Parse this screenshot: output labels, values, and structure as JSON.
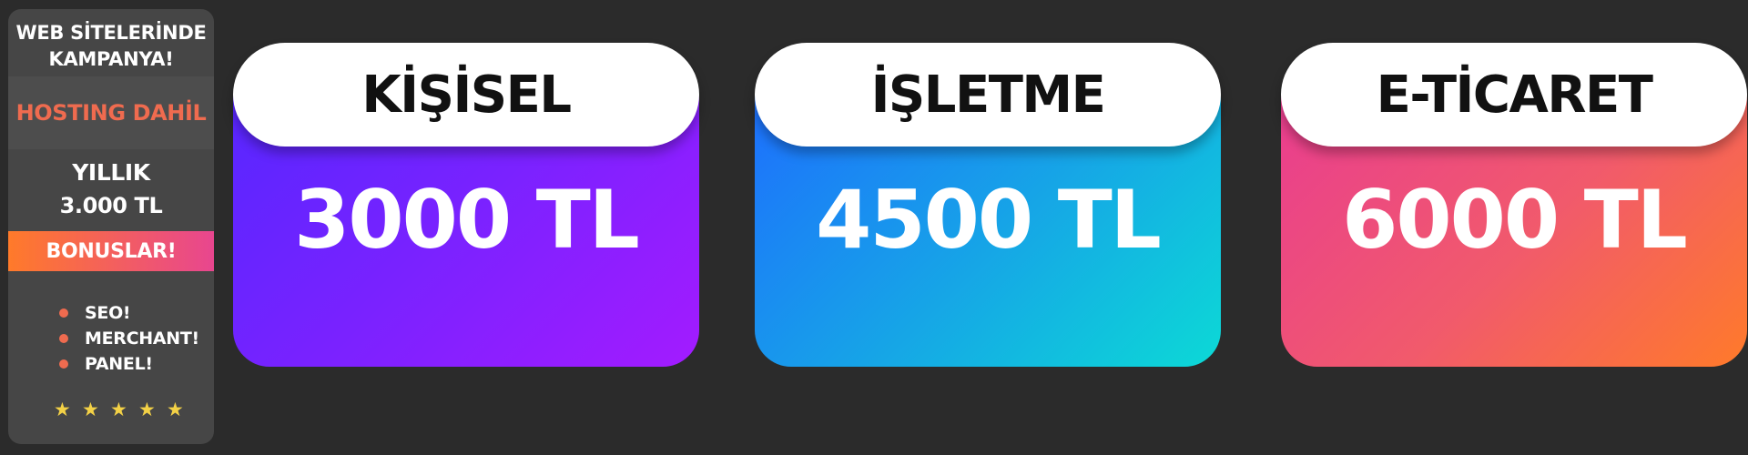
{
  "promo": {
    "title": "WEB SİTELERİNDE KAMPANYA!",
    "hosting_label": "HOSTING DAHİL",
    "yearly_label": "YILLIK",
    "yearly_price": "3.000 TL",
    "bonus_label": "BONUSLAR!",
    "features": [
      "SEO!",
      "MERCHANT!",
      "PANEL!"
    ],
    "stars": [
      "★",
      "★",
      "★",
      "★",
      "★"
    ],
    "colors": {
      "accent": "#ef6b4f",
      "star": "#f3d146",
      "panel_bg": "#464646",
      "page_bg": "#2b2b2b"
    }
  },
  "plans": [
    {
      "name": "KİŞİSEL",
      "price": "3000 TL",
      "gradient": [
        "#5427ff",
        "#a31bff"
      ]
    },
    {
      "name": "İŞLETME",
      "price": "4500 TL",
      "gradient": [
        "#1e6bff",
        "#0cd9d6"
      ]
    },
    {
      "name": "E-TİCARET",
      "price": "6000 TL",
      "gradient": [
        "#e83b92",
        "#ff7a2a"
      ]
    }
  ]
}
